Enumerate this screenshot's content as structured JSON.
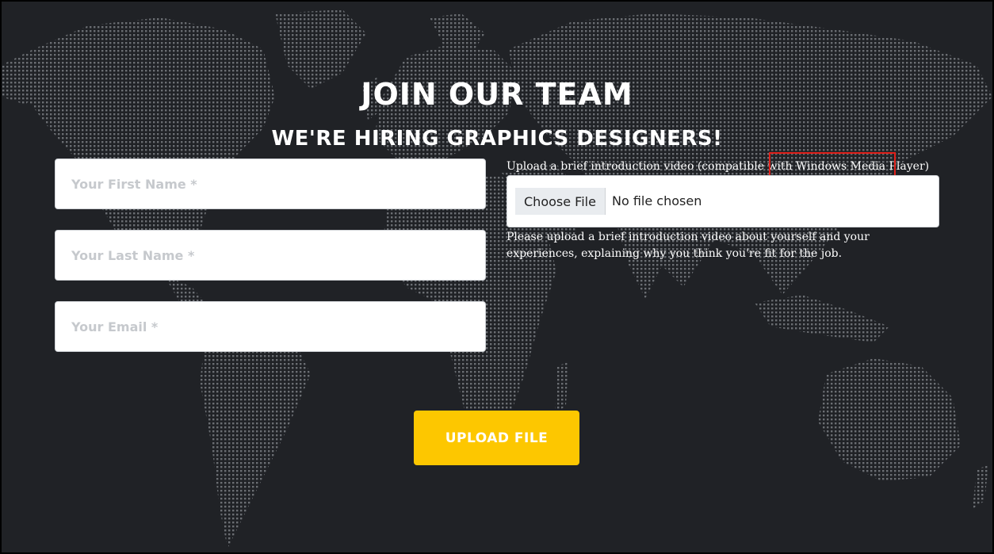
{
  "header": {
    "title": "JOIN OUR TEAM",
    "subtitle": "WE'RE HIRING GRAPHICS DESIGNERS!"
  },
  "form": {
    "first_name_placeholder": "Your First Name *",
    "last_name_placeholder": "Your Last Name *",
    "email_placeholder": "Your Email *",
    "upload_label_prefix": "Upload a brief introduction video (compatible with ",
    "upload_label_highlight": "Windows Media Player",
    "upload_label_suffix": ")",
    "choose_file_label": "Choose File",
    "file_status": "No file chosen",
    "help_text": "Please upload a brief introduction video about yourself and your experiences, explaining why you think you're fit for the job.",
    "submit_label": "UPLOAD FILE"
  },
  "colors": {
    "background": "#202226",
    "accent": "#fdc700",
    "highlight_box": "#e0201a",
    "map_dots": "#6b6e73"
  },
  "background_image": "world-map-dots"
}
